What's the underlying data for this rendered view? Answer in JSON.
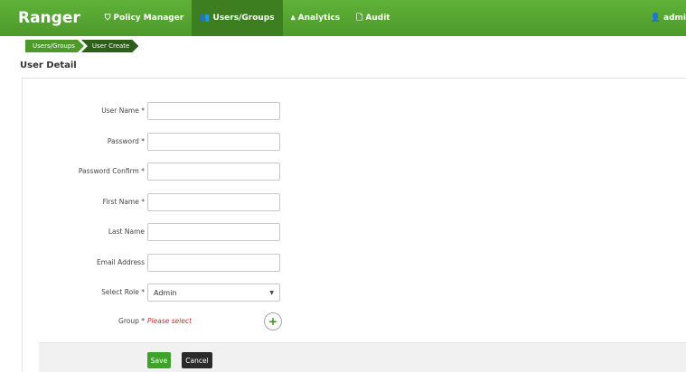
{
  "nav": {
    "brand": "Ranger",
    "items": [
      {
        "label": "Policy Manager",
        "icon": "shield-icon",
        "glyph": "⛉",
        "active": false
      },
      {
        "label": "Users/Groups",
        "icon": "users-icon",
        "glyph": "👥",
        "active": true
      },
      {
        "label": "Analytics",
        "icon": "analytics-icon",
        "glyph": "⩓",
        "active": false
      },
      {
        "label": "Audit",
        "icon": "document-icon",
        "glyph": "🗋",
        "active": false
      }
    ],
    "user_label": "admi",
    "user_glyph": "👤"
  },
  "breadcrumb": {
    "items": [
      "Users/Groups",
      "User Create"
    ]
  },
  "page_title": "User Detail",
  "form": {
    "fields": [
      {
        "label": "User Name *",
        "value": ""
      },
      {
        "label": "Password *",
        "value": ""
      },
      {
        "label": "Password Confirm *",
        "value": ""
      },
      {
        "label": "First Name *",
        "value": ""
      },
      {
        "label": "Last Name",
        "value": ""
      },
      {
        "label": "Email Address",
        "value": ""
      }
    ],
    "role": {
      "label": "Select Role *",
      "value": "Admin",
      "caret": "▼"
    },
    "group": {
      "label": "Group *",
      "placeholder": "Please select",
      "add_glyph": "+"
    },
    "save_label": "Save",
    "cancel_label": "Cancel"
  },
  "colors": {
    "brand_green": "#4d9a2b",
    "active_nav": "#3d7f20",
    "error_red": "#c0392b"
  }
}
